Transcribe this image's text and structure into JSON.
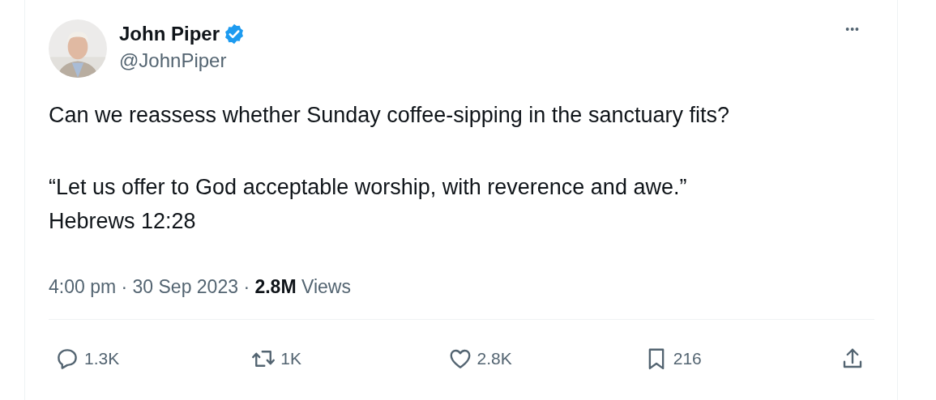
{
  "author": {
    "name": "John Piper",
    "verified": true,
    "handle": "@JohnPiper"
  },
  "more_button": "•••",
  "body": [
    "Can we reassess whether Sunday coffee-sipping in the sanctuary fits?",
    "“Let us offer to God acceptable worship, with reverence and awe.”\nHebrews 12:28"
  ],
  "meta": "4:00 pm · 30 Sep 2023 · **2.8M** Views",
  "actions": [
    {
      "kind": "reply",
      "count": "1.3K"
    },
    {
      "kind": "retweet",
      "count": "1K"
    },
    {
      "kind": "like",
      "count": "2.8K"
    },
    {
      "kind": "bookmark",
      "count": "216"
    },
    {
      "kind": "share"
    }
  ]
}
